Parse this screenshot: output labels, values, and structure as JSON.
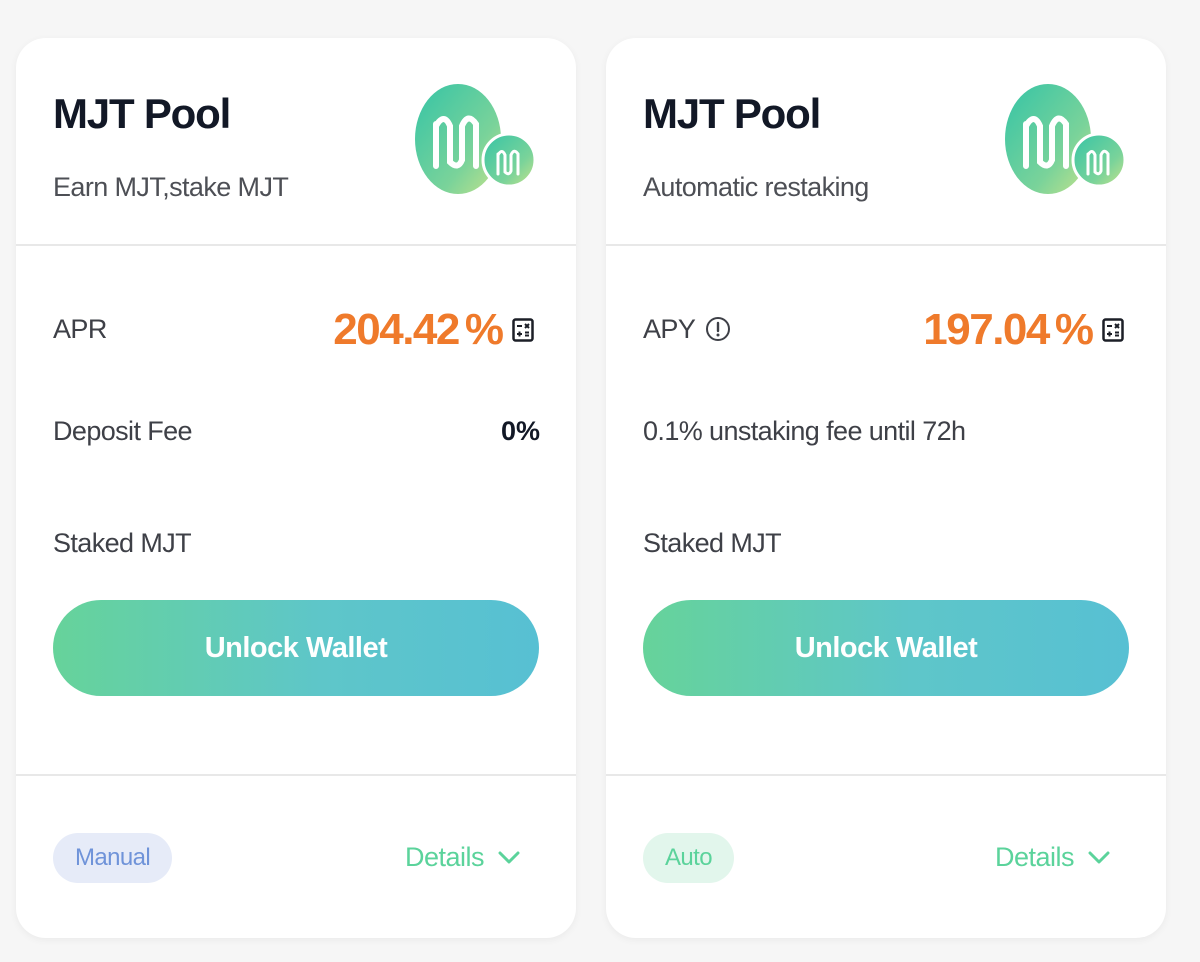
{
  "colors": {
    "accent_orange": "#ef7a2b",
    "accent_green": "#5bd39b",
    "manual_badge_text": "#6f93d9",
    "button_gradient": [
      "#66d39a",
      "#57c0d3"
    ]
  },
  "cards": [
    {
      "title": "MJT Pool",
      "subtitle": "Earn MJT,stake MJT",
      "rate_label": "APR",
      "rate_value": "204.42",
      "rate_unit": "%",
      "fee_label": "Deposit Fee",
      "fee_value": "0%",
      "staked_label": "Staked MJT",
      "button_label": "Unlock Wallet",
      "badge": "Manual",
      "details_label": "Details",
      "icons": [
        "mjt-logo-icon",
        "calculator-icon",
        "chevron-down-icon"
      ]
    },
    {
      "title": "MJT Pool",
      "subtitle": "Automatic restaking",
      "rate_label": "APY",
      "rate_value": "197.04",
      "rate_unit": "%",
      "fee_label": "0.1% unstaking fee until 72h",
      "staked_label": "Staked MJT",
      "button_label": "Unlock Wallet",
      "badge": "Auto",
      "details_label": "Details",
      "icons": [
        "mjt-logo-icon",
        "info-icon",
        "calculator-icon",
        "chevron-down-icon"
      ]
    }
  ]
}
